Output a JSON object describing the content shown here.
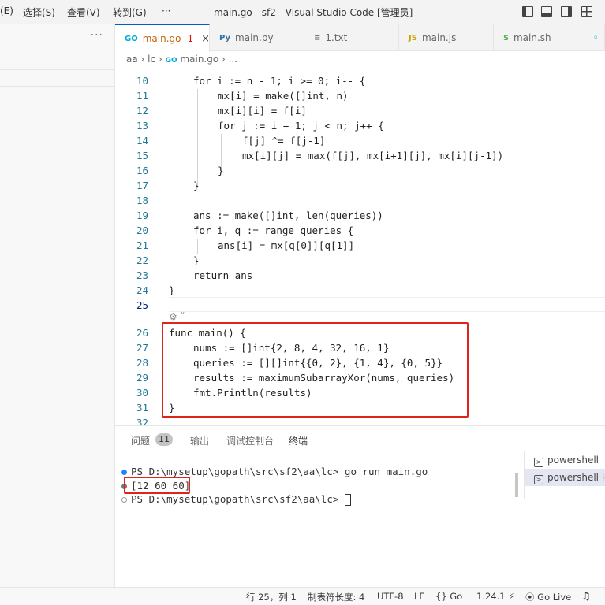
{
  "titlebar": {
    "menu_edit": "(E)",
    "menu_select": "选择(S)",
    "menu_view": "查看(V)",
    "menu_goto": "转到(G)",
    "menu_more": "···",
    "title": "main.go - sf2 - Visual Studio Code [管理员]"
  },
  "sidebar": {
    "more": "···"
  },
  "tabs": [
    {
      "label": "main.go",
      "icon": "GO",
      "badge": "1",
      "close": "×",
      "color": "#00add8"
    },
    {
      "label": "main.py",
      "icon": "Py",
      "color": "#3572a5"
    },
    {
      "label": "1.txt",
      "icon": "≡",
      "color": "#777777"
    },
    {
      "label": "main.js",
      "icon": "JS",
      "color": "#c9a200"
    },
    {
      "label": "main.sh",
      "icon": "$",
      "color": "#4caf50"
    }
  ],
  "breadcrumb": {
    "p1": "aa",
    "p2": "lc",
    "p3": "main.go",
    "p4": "..."
  },
  "editor": {
    "lines": [
      {
        "no": "10",
        "text": "for i := n - 1; i >= 0; i-- {"
      },
      {
        "no": "11",
        "text": "mx[i] = make([]int, n)"
      },
      {
        "no": "12",
        "text": "mx[i][i] = f[i]"
      },
      {
        "no": "13",
        "text": "for j := i + 1; j < n; j++ {"
      },
      {
        "no": "14",
        "text": "f[j] ^= f[j-1]"
      },
      {
        "no": "15",
        "text": "mx[i][j] = max(f[j], mx[i+1][j], mx[i][j-1])"
      },
      {
        "no": "16",
        "text": "}"
      },
      {
        "no": "17",
        "text": "}"
      },
      {
        "no": "18",
        "text": ""
      },
      {
        "no": "19",
        "text": "ans := make([]int, len(queries))"
      },
      {
        "no": "20",
        "text": "for i, q := range queries {"
      },
      {
        "no": "21",
        "text": "ans[i] = mx[q[0]][q[1]]"
      },
      {
        "no": "22",
        "text": "}"
      },
      {
        "no": "23",
        "text": "return ans"
      },
      {
        "no": "24",
        "text": "}"
      },
      {
        "no": "25",
        "text": ""
      },
      {
        "no": "26",
        "text": "func main() {"
      },
      {
        "no": "27",
        "text": "nums := []int{2, 8, 4, 32, 16, 1}"
      },
      {
        "no": "28",
        "text": "queries := [][]int{{0, 2}, {1, 4}, {0, 5}}"
      },
      {
        "no": "29",
        "text": "results := maximumSubarrayXor(nums, queries)"
      },
      {
        "no": "30",
        "text": "fmt.Println(results)"
      },
      {
        "no": "31",
        "text": "}"
      },
      {
        "no": "32",
        "text": ""
      }
    ]
  },
  "panel": {
    "tab_problems": "问题",
    "problems_count": "11",
    "tab_output": "输出",
    "tab_debug": "调试控制台",
    "tab_terminal": "终端",
    "terminal_lines": [
      "PS D:\\mysetup\\gopath\\src\\sf2\\aa\\lc> go run main.go",
      "[12 60 60]",
      "PS D:\\mysetup\\gopath\\src\\sf2\\aa\\lc> "
    ],
    "terminals": [
      "powershell",
      "powershell lc"
    ]
  },
  "statusbar": {
    "position": "行 25，列 1",
    "tab_size": "制表符长度: 4",
    "encoding": "UTF-8",
    "eol": "LF",
    "language": "Go",
    "go_version": "1.24.1",
    "go_live": "Go Live"
  }
}
